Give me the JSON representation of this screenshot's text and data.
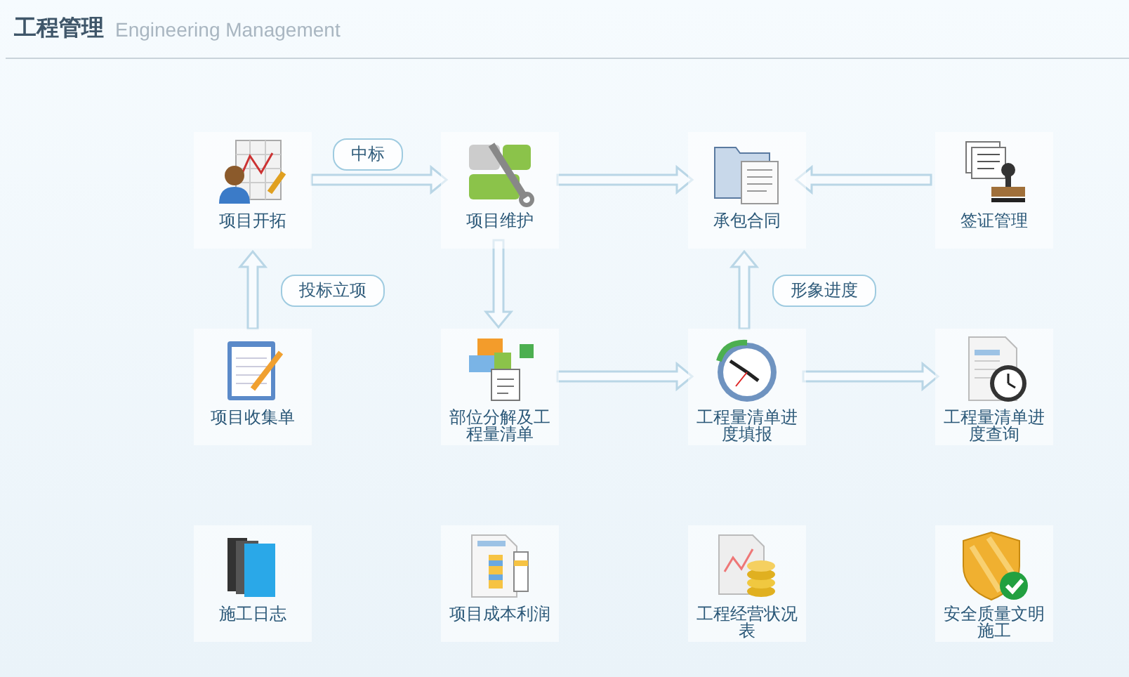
{
  "header": {
    "title": "工程管理",
    "subtitle": "Engineering Management"
  },
  "nodes": [
    {
      "label": "项目开拓"
    },
    {
      "label": "项目维护"
    },
    {
      "label": "承包合同"
    },
    {
      "label": "签证管理"
    },
    {
      "label": "项目收集单"
    },
    {
      "label": "部位分解及工程量清单"
    },
    {
      "label": "工程量清单进度填报"
    },
    {
      "label": "工程量清单进度查询"
    },
    {
      "label": "施工日志"
    },
    {
      "label": "项目成本利润"
    },
    {
      "label": "工程经营状况表"
    },
    {
      "label": "安全质量文明施工"
    }
  ],
  "flow_labels": [
    "中标",
    "投标立项",
    "形象进度"
  ]
}
